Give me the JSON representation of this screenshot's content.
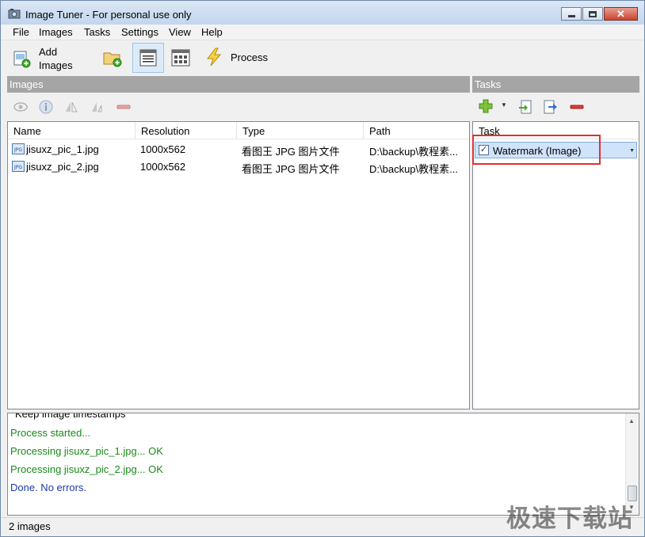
{
  "window": {
    "title": "Image Tuner - For personal use only",
    "close_glyph": "✕"
  },
  "menu": [
    "File",
    "Images",
    "Tasks",
    "Settings",
    "View",
    "Help"
  ],
  "toolbar": {
    "add_images_line1": "Add",
    "add_images_line2": "Images",
    "process_label": "Process",
    "icons": [
      "add-images-icon",
      "add-folder-icon",
      "details-view-icon",
      "thumbnails-view-icon",
      "lightning-icon"
    ]
  },
  "images_panel": {
    "header": "Images",
    "columns": [
      "Name",
      "Resolution",
      "Type",
      "Path"
    ],
    "rows": [
      {
        "name": "jisuxz_pic_1.jpg",
        "resolution": "1000x562",
        "type": "看图王 JPG 图片文件",
        "path": "D:\\backup\\教程素..."
      },
      {
        "name": "jisuxz_pic_2.jpg",
        "resolution": "1000x562",
        "type": "看图王 JPG 图片文件",
        "path": "D:\\backup\\教程素..."
      }
    ],
    "icon_badge": "JPG"
  },
  "tasks_panel": {
    "header": "Tasks",
    "column": "Task",
    "items": [
      {
        "label": "Watermark (Image)",
        "checked": true
      }
    ],
    "check_glyph": "✓",
    "dropdown_glyph": "▼"
  },
  "log": {
    "lines": [
      {
        "text": "Keep image timestamps",
        "color": "#000000"
      },
      {
        "text": "Process started...",
        "color": "#1a8a1a"
      },
      {
        "text": "Processing jisuxz_pic_1.jpg... OK",
        "color": "#1a8a1a"
      },
      {
        "text": "Processing jisuxz_pic_2.jpg... OK",
        "color": "#1a8a1a"
      },
      {
        "text": "Done. No errors.",
        "color": "#1f3aa8"
      }
    ],
    "scroll_up": "▲",
    "scroll_down": "▼"
  },
  "status": {
    "text": "2 images"
  },
  "watermark_logo": "极速下载站",
  "colors": {
    "highlight_box": "#e03030",
    "selection": "#cfe3fb",
    "panel_header": "#a5a5a5"
  }
}
